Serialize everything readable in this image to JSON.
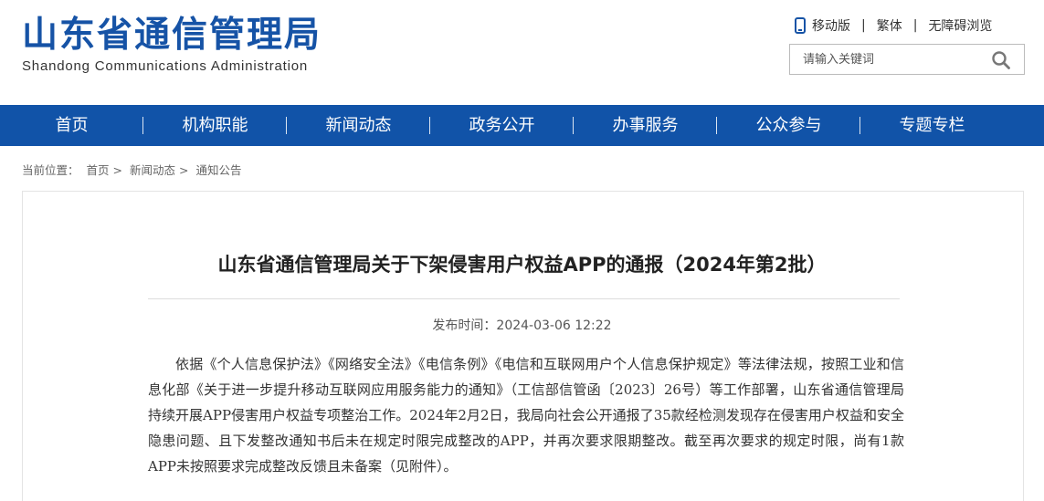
{
  "header": {
    "logo_cn": "山东省通信管理局",
    "logo_en": "Shandong Communications Administration",
    "top_links": [
      "移动版",
      "繁体",
      "无障碍浏览"
    ],
    "phone_icon": "mobile-phone-icon",
    "search": {
      "placeholder": "请输入关键词",
      "icon": "search-icon"
    }
  },
  "nav": {
    "items": [
      "首页",
      "机构职能",
      "新闻动态",
      "政务公开",
      "办事服务",
      "公众参与",
      "专题专栏"
    ]
  },
  "breadcrumb": {
    "prefix": "当前位置：",
    "items": [
      "首页",
      "新闻动态",
      "通知公告"
    ],
    "separator": ">"
  },
  "article": {
    "title": "山东省通信管理局关于下架侵害用户权益APP的通报（2024年第2批）",
    "pubtime": "发布时间：2024-03-06 12:22",
    "paragraph": "依据《个人信息保护法》《网络安全法》《电信条例》《电信和互联网用户个人信息保护规定》等法律法规，按照工业和信息化部《关于进一步提升移动互联网应用服务能力的通知》（工信部信管函〔2023〕26号）等工作部署，山东省通信管理局持续开展APP侵害用户权益专项整治工作。2024年2月2日，我局向社会公开通报了35款经检测发现存在侵害用户权益和安全隐患问题、且下发整改通知书后未在规定时限完成整改的APP，并再次要求限期整改。截至再次要求的规定时限，尚有1款APP未按照要求完成整改反馈且未备案（见附件）。"
  },
  "colors": {
    "brand": "#1653a6",
    "nav_bg": "#1153a8"
  }
}
